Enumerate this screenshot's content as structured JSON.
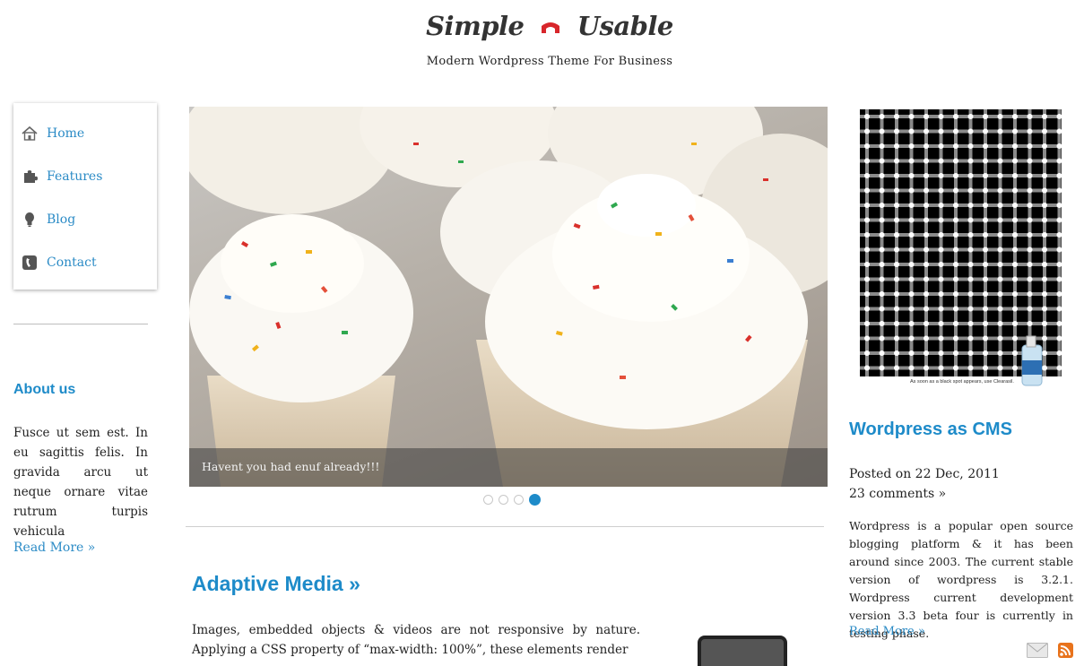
{
  "header": {
    "logo_word_1": "Simple",
    "logo_word_2": "Usable",
    "tagline": "Modern Wordpress Theme For Business"
  },
  "nav": {
    "items": [
      {
        "label": "Home",
        "icon": "home-icon"
      },
      {
        "label": "Features",
        "icon": "puzzle-icon"
      },
      {
        "label": "Blog",
        "icon": "lightbulb-icon"
      },
      {
        "label": "Contact",
        "icon": "phone-icon"
      }
    ]
  },
  "about": {
    "title": "About us",
    "text": "Fusce ut sem est. In eu sagittis felis. In gravida arcu ut neque ornare vitae rutrum turpis vehicula",
    "read_more": "Read More »"
  },
  "slider": {
    "caption": "Havent you had enuf already!!!",
    "slide_count": 4,
    "active_slide": 4
  },
  "main_post": {
    "title": "Adaptive Media »",
    "excerpt": "Images, embedded objects & videos are not responsive by nature. Applying a CSS property of “max-width: 100%”, these elements render"
  },
  "sidebar_post": {
    "image_caption": "As soon as a black spot appears, use Clearasil.",
    "title": "Wordpress as CMS",
    "posted_on": "Posted on 22 Dec, 2011",
    "comments": "23 comments »",
    "text": "Wordpress is a popular open source blogging platform & it has been around since 2003. The current stable version of wordpress is 3.2.1. Wordpress current development version 3.3 beta four is currently in testing phase.",
    "read_more": "Read More »"
  },
  "footer_icons": [
    "mail-icon",
    "rss-icon"
  ],
  "colors": {
    "accent_blue": "#1e8bc9",
    "link_blue": "#2b8bc6",
    "logo_red": "#d8262b",
    "rss_orange": "#e8731c"
  }
}
